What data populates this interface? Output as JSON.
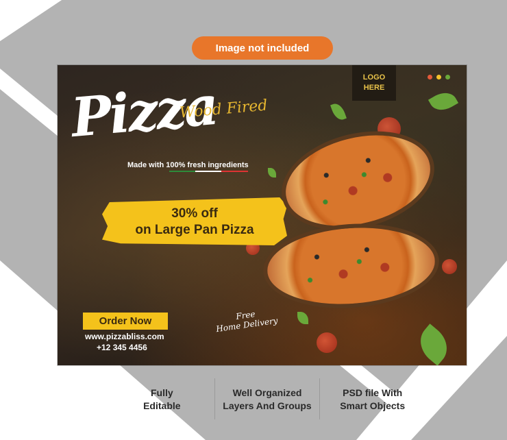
{
  "badge": {
    "label": "Image not included"
  },
  "banner": {
    "logo": {
      "line1": "LOGO",
      "line2": "HERE"
    },
    "dots": [
      "#e35a3a",
      "#f3c12b",
      "#6aa83a"
    ],
    "title_sub": "Wood Fired",
    "title_main": "Pizza",
    "tagline": "Made with 100% fresh ingredients",
    "offer_line1": "30% off",
    "offer_line2": "on Large Pan Pizza",
    "delivery_line1": "Free",
    "delivery_line2": "Home Delivery",
    "order_button": "Order Now",
    "website": "www.pizzabliss.com",
    "phone": "+12 345 4456"
  },
  "features": {
    "item1_line1": "Fully",
    "item1_line2": "Editable",
    "item2_line1": "Well Organized",
    "item2_line2": "Layers And Groups",
    "item3_line1": "PSD file With",
    "item3_line2": "Smart Objects"
  },
  "colors": {
    "accent_orange": "#e8762a",
    "accent_yellow": "#f4c21b",
    "background_grey": "#b3b3b3"
  }
}
